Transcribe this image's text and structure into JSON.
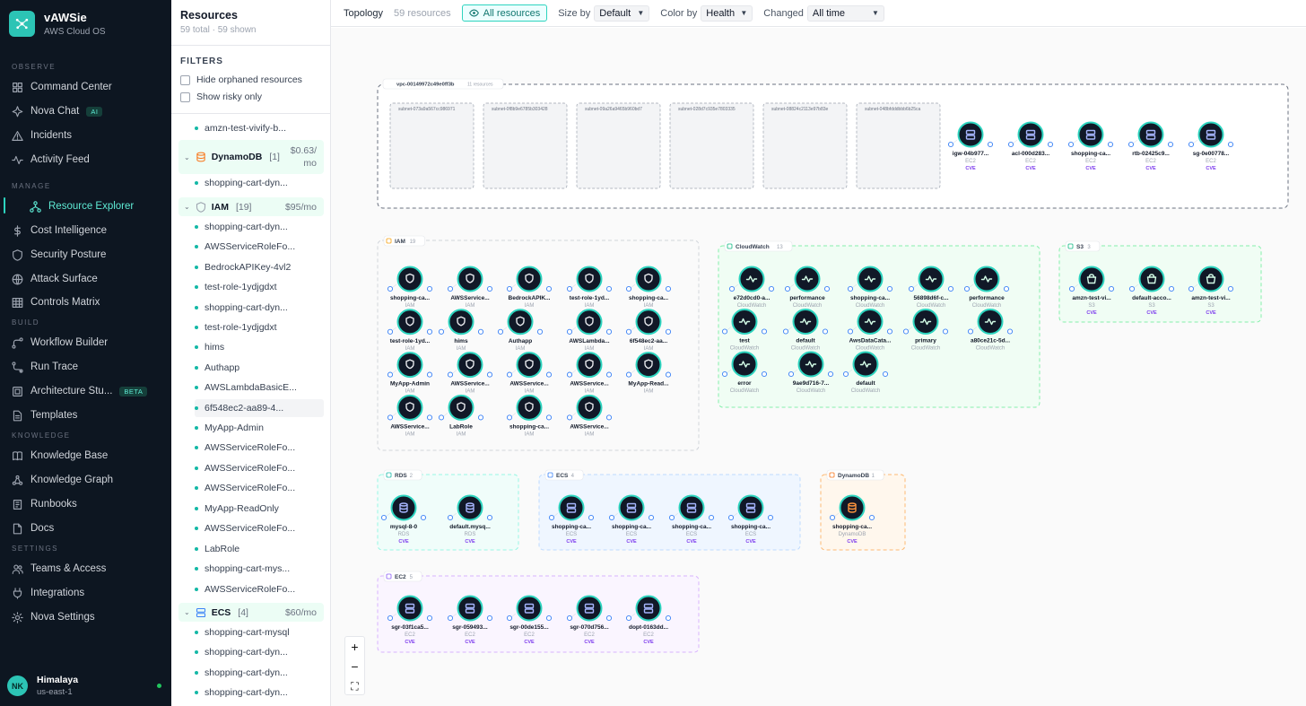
{
  "app": {
    "name": "vAWSie",
    "subtitle": "AWS Cloud OS"
  },
  "nav": {
    "sections": [
      "OBSERVE",
      "MANAGE",
      "BUILD",
      "KNOWLEDGE",
      "SETTINGS"
    ],
    "items": [
      {
        "label": "Command Center",
        "icon": "grid-icon"
      },
      {
        "label": "Nova Chat",
        "icon": "sparkle-icon",
        "badge": "AI"
      },
      {
        "label": "Incidents",
        "icon": "alert-triangle-icon"
      },
      {
        "label": "Activity Feed",
        "icon": "activity-icon"
      },
      {
        "label": "Resource Explorer",
        "icon": "network-icon",
        "active": true
      },
      {
        "label": "Cost Intelligence",
        "icon": "dollar-icon"
      },
      {
        "label": "Security Posture",
        "icon": "shield-icon"
      },
      {
        "label": "Attack Surface",
        "icon": "globe-icon"
      },
      {
        "label": "Controls Matrix",
        "icon": "table-icon"
      },
      {
        "label": "Workflow Builder",
        "icon": "workflow-icon"
      },
      {
        "label": "Run Trace",
        "icon": "trace-icon"
      },
      {
        "label": "Architecture Stu...",
        "icon": "architecture-icon",
        "badge": "BETA"
      },
      {
        "label": "Templates",
        "icon": "file-icon"
      },
      {
        "label": "Knowledge Base",
        "icon": "book-icon"
      },
      {
        "label": "Knowledge Graph",
        "icon": "graph-icon"
      },
      {
        "label": "Runbooks",
        "icon": "runbook-icon"
      },
      {
        "label": "Docs",
        "icon": "doc-icon"
      },
      {
        "label": "Teams & Access",
        "icon": "users-icon"
      },
      {
        "label": "Integrations",
        "icon": "plug-icon"
      },
      {
        "label": "Nova Settings",
        "icon": "gear-icon"
      }
    ],
    "user": {
      "initials": "NK",
      "name": "Himalaya",
      "region": "us-east-1"
    }
  },
  "resources": {
    "title": "Resources",
    "subtitle": "59 total · 59 shown",
    "filters_title": "FILTERS",
    "filters": [
      "Hide orphaned resources",
      "Show risky only"
    ],
    "list": [
      {
        "kind": "leaf",
        "label": "amzn-test-vivify-b..."
      },
      {
        "kind": "group",
        "name": "DynamoDB",
        "count": "[1]",
        "price": "$0.63/ mo",
        "icon": "database-icon"
      },
      {
        "kind": "leaf",
        "label": "shopping-cart-dyn..."
      },
      {
        "kind": "group",
        "name": "IAM",
        "count": "[19]",
        "price": "$95/mo",
        "icon": "shield-icon"
      },
      {
        "kind": "leaf",
        "label": "shopping-cart-dyn..."
      },
      {
        "kind": "leaf",
        "label": "AWSServiceRoleFo..."
      },
      {
        "kind": "leaf",
        "label": "BedrockAPIKey-4vl2"
      },
      {
        "kind": "leaf",
        "label": "test-role-1ydjgdxt"
      },
      {
        "kind": "leaf",
        "label": "shopping-cart-dyn..."
      },
      {
        "kind": "leaf",
        "label": "test-role-1ydjgdxt"
      },
      {
        "kind": "leaf",
        "label": "hims"
      },
      {
        "kind": "leaf",
        "label": "Authapp"
      },
      {
        "kind": "leaf",
        "label": "AWSLambdaBasicE..."
      },
      {
        "kind": "leaf",
        "label": "6f548ec2-aa89-4...",
        "selected": true
      },
      {
        "kind": "leaf",
        "label": "MyApp-Admin"
      },
      {
        "kind": "leaf",
        "label": "AWSServiceRoleFo..."
      },
      {
        "kind": "leaf",
        "label": "AWSServiceRoleFo..."
      },
      {
        "kind": "leaf",
        "label": "AWSServiceRoleFo..."
      },
      {
        "kind": "leaf",
        "label": "MyApp-ReadOnly"
      },
      {
        "kind": "leaf",
        "label": "AWSServiceRoleFo..."
      },
      {
        "kind": "leaf",
        "label": "LabRole"
      },
      {
        "kind": "leaf",
        "label": "shopping-cart-mys..."
      },
      {
        "kind": "leaf",
        "label": "AWSServiceRoleFo..."
      },
      {
        "kind": "group",
        "name": "ECS",
        "count": "[4]",
        "price": "$60/mo",
        "icon": "server-icon"
      },
      {
        "kind": "leaf",
        "label": "shopping-cart-mysql"
      },
      {
        "kind": "leaf",
        "label": "shopping-cart-dyn..."
      },
      {
        "kind": "leaf",
        "label": "shopping-cart-dyn..."
      },
      {
        "kind": "leaf",
        "label": "shopping-cart-dyn..."
      }
    ]
  },
  "toolbar": {
    "title": "Topology",
    "count": "59 resources",
    "all_resources": "All resources",
    "size_by_label": "Size by",
    "size_by_value": "Default",
    "color_by_label": "Color by",
    "color_by_value": "Health",
    "changed_label": "Changed",
    "changed_value": "All time"
  },
  "colors": {
    "accent": "#2dd4bf",
    "sidebar": "#0d1621",
    "cve": "#7c3aed",
    "iam": "#f59e0b",
    "dynamo": "#f97316"
  },
  "zoom_controls": [
    "+",
    "−",
    "⛶"
  ],
  "topology": {
    "vpc": {
      "label": "vpc-00149972c49e0ff3b",
      "count": "11 resources",
      "subnets": [
        "subnet-073a9a567cc986971",
        "subnet-0f8b9e6785b303428",
        "subnet-09a26a9465b960bd7",
        "subnet-028d7c935e7803335",
        "subnet-08824c2113e97b83e",
        "subnet-048bfdddbbb6b25ca"
      ],
      "nodes": [
        {
          "name": "igw-04b977...",
          "type": "EC2",
          "cve": true
        },
        {
          "name": "acl-000d283...",
          "type": "EC2",
          "cve": true
        },
        {
          "name": "shopping-ca...",
          "type": "EC2",
          "cve": true
        },
        {
          "name": "rtb-02425c9...",
          "type": "EC2",
          "cve": true
        },
        {
          "name": "sg-0e00778...",
          "type": "EC2",
          "cve": true
        }
      ]
    },
    "groups": [
      {
        "id": "iam",
        "label": "IAM",
        "count": "19",
        "nodes": [
          {
            "name": "shopping-ca...",
            "type": "IAM"
          },
          {
            "name": "AWSService...",
            "type": "IAM"
          },
          {
            "name": "BedrockAPIK...",
            "type": "IAM"
          },
          {
            "name": "test-role-1yd...",
            "type": "IAM"
          },
          {
            "name": "shopping-ca...",
            "type": "IAM"
          },
          {
            "name": "test-role-1yd...",
            "type": "IAM"
          },
          {
            "name": "hims",
            "type": "IAM"
          },
          {
            "name": "Authapp",
            "type": "IAM"
          },
          {
            "name": "AWSLambda...",
            "type": "IAM"
          },
          {
            "name": "6f548ec2-aa...",
            "type": "IAM"
          },
          {
            "name": "MyApp-Admin",
            "type": "IAM"
          },
          {
            "name": "AWSService...",
            "type": "IAM"
          },
          {
            "name": "AWSService...",
            "type": "IAM"
          },
          {
            "name": "AWSService...",
            "type": "IAM"
          },
          {
            "name": "MyApp-Read...",
            "type": "IAM"
          },
          {
            "name": "AWSService...",
            "type": "IAM"
          },
          {
            "name": "LabRole",
            "type": "IAM"
          },
          {
            "name": "shopping-ca...",
            "type": "IAM"
          },
          {
            "name": "AWSService...",
            "type": "IAM"
          }
        ]
      },
      {
        "id": "cloudwatch",
        "label": "CloudWatch",
        "count": "13",
        "nodes": [
          {
            "name": "e72d0cd0-a...",
            "type": "CloudWatch"
          },
          {
            "name": "performance",
            "type": "CloudWatch"
          },
          {
            "name": "shopping-ca...",
            "type": "CloudWatch"
          },
          {
            "name": "56898d6f-c...",
            "type": "CloudWatch"
          },
          {
            "name": "performance",
            "type": "CloudWatch"
          },
          {
            "name": "test",
            "type": "CloudWatch"
          },
          {
            "name": "default",
            "type": "CloudWatch"
          },
          {
            "name": "AwsDataCata...",
            "type": "CloudWatch"
          },
          {
            "name": "primary",
            "type": "CloudWatch"
          },
          {
            "name": "a80ce21c-5d...",
            "type": "CloudWatch"
          },
          {
            "name": "error",
            "type": "CloudWatch"
          },
          {
            "name": "9ae9d716-7...",
            "type": "CloudWatch"
          },
          {
            "name": "default",
            "type": "CloudWatch"
          }
        ]
      },
      {
        "id": "s3",
        "label": "S3",
        "count": "3",
        "nodes": [
          {
            "name": "amzn-test-vi...",
            "type": "S3",
            "cve": true
          },
          {
            "name": "default-acco...",
            "type": "S3",
            "cve": true
          },
          {
            "name": "amzn-test-vi...",
            "type": "S3",
            "cve": true
          }
        ]
      },
      {
        "id": "rds",
        "label": "RDS",
        "count": "2",
        "nodes": [
          {
            "name": "mysql-8-0",
            "type": "RDS",
            "cve": true
          },
          {
            "name": "default.mysq...",
            "type": "RDS",
            "cve": true
          }
        ]
      },
      {
        "id": "ecs",
        "label": "ECS",
        "count": "4",
        "nodes": [
          {
            "name": "shopping-ca...",
            "type": "ECS",
            "cve": true
          },
          {
            "name": "shopping-ca...",
            "type": "ECS",
            "cve": true
          },
          {
            "name": "shopping-ca...",
            "type": "ECS",
            "cve": true
          },
          {
            "name": "shopping-ca...",
            "type": "ECS",
            "cve": true
          }
        ]
      },
      {
        "id": "dynamodb",
        "label": "DynamoDB",
        "count": "1",
        "nodes": [
          {
            "name": "shopping-ca...",
            "type": "DynamoDB",
            "cve": true
          }
        ]
      },
      {
        "id": "ec2",
        "label": "EC2",
        "count": "5",
        "nodes": [
          {
            "name": "sgr-03f1ca5...",
            "type": "EC2",
            "cve": true
          },
          {
            "name": "sgr-059493...",
            "type": "EC2",
            "cve": true
          },
          {
            "name": "sgr-00de155...",
            "type": "EC2",
            "cve": true
          },
          {
            "name": "sgr-070d756...",
            "type": "EC2",
            "cve": true
          },
          {
            "name": "dopt-0163dd...",
            "type": "EC2",
            "cve": true
          }
        ]
      }
    ],
    "cve_label": "CVE"
  }
}
